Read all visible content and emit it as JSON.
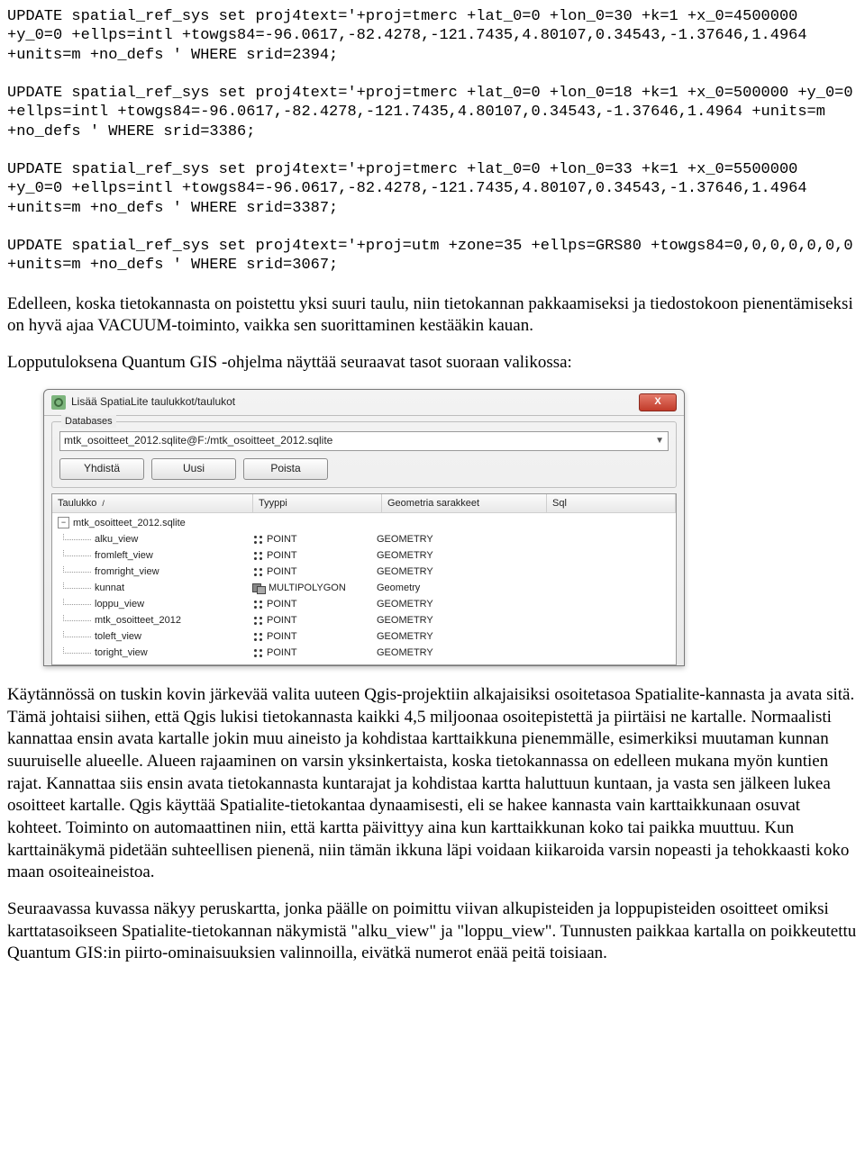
{
  "sql": {
    "stmt1": "UPDATE spatial_ref_sys set proj4text='+proj=tmerc +lat_0=0 +lon_0=30 +k=1 +x_0=4500000 +y_0=0 +ellps=intl +towgs84=-96.0617,-82.4278,-121.7435,4.80107,0.34543,-1.37646,1.4964 +units=m +no_defs ' WHERE srid=2394;",
    "stmt2": "UPDATE spatial_ref_sys set proj4text='+proj=tmerc +lat_0=0 +lon_0=18 +k=1 +x_0=500000 +y_0=0 +ellps=intl +towgs84=-96.0617,-82.4278,-121.7435,4.80107,0.34543,-1.37646,1.4964 +units=m +no_defs ' WHERE srid=3386;",
    "stmt3": "UPDATE spatial_ref_sys set proj4text='+proj=tmerc +lat_0=0 +lon_0=33 +k=1 +x_0=5500000 +y_0=0 +ellps=intl +towgs84=-96.0617,-82.4278,-121.7435,4.80107,0.34543,-1.37646,1.4964 +units=m +no_defs ' WHERE srid=3387;",
    "stmt4": "UPDATE spatial_ref_sys set proj4text='+proj=utm +zone=35 +ellps=GRS80 +towgs84=0,0,0,0,0,0,0 +units=m +no_defs ' WHERE srid=3067;"
  },
  "paragraphs": {
    "p1": "Edelleen, koska tietokannasta on poistettu yksi suuri taulu, niin tietokannan pakkaamiseksi ja tiedostokoon pienentämiseksi on hyvä ajaa VACUUM-toiminto, vaikka sen suorittaminen kestääkin kauan.",
    "p2": "Lopputuloksena Quantum GIS -ohjelma näyttää seuraavat tasot suoraan valikossa:",
    "p3": "Käytännössä on tuskin kovin järkevää valita uuteen Qgis-projektiin alkajaisiksi osoitetasoa Spatialite-kannasta ja avata sitä.  Tämä johtaisi siihen, että Qgis lukisi tietokannasta kaikki 4,5 miljoonaa osoitepistettä ja piirtäisi ne kartalle.  Normaalisti kannattaa ensin avata kartalle jokin muu aineisto ja kohdistaa karttaikkuna pienemmälle, esimerkiksi muutaman kunnan suuruiselle alueelle.  Alueen rajaaminen on varsin yksinkertaista, koska tietokannassa on edelleen mukana myön kuntien rajat.  Kannattaa siis ensin avata tietokannasta kuntarajat ja kohdistaa kartta haluttuun kuntaan, ja vasta sen jälkeen lukea osoitteet kartalle.  Qgis käyttää Spatialite-tietokantaa dynaamisesti, eli se hakee kannasta vain karttaikkunaan osuvat kohteet.  Toiminto on automaattinen niin, että kartta päivittyy aina kun karttaikkunan koko tai paikka muuttuu.  Kun karttainäkymä pidetään suhteellisen pienenä, niin tämän ikkuna läpi voidaan kiikaroida varsin nopeasti ja tehokkaasti koko maan osoiteaineistoa.",
    "p4": "Seuraavassa kuvassa näkyy  peruskartta, jonka päälle on poimittu viivan alkupisteiden ja loppupisteiden osoitteet omiksi karttatasoikseen Spatialite-tietokannan näkymistä \"alku_view\" ja \"loppu_view\".  Tunnusten paikkaa kartalla on poikkeutettu Quantum GIS:in piirto-ominaisuuksien valinnoilla, eivätkä numerot enää peitä toisiaan."
  },
  "dialog": {
    "title": "Lisää SpatiaLite taulukkot/taulukot",
    "close": "X",
    "group_label": "Databases",
    "combo_value": "mtk_osoitteet_2012.sqlite@F:/mtk_osoitteet_2012.sqlite",
    "btn_connect": "Yhdistä",
    "btn_new": "Uusi",
    "btn_delete": "Poista",
    "headers": {
      "table": "Taulukko",
      "type": "Tyyppi",
      "geom": "Geometria sarakkeet",
      "sql": "Sql"
    },
    "root": "mtk_osoitteet_2012.sqlite",
    "rows": [
      {
        "name": "alku_view",
        "type": "POINT",
        "geom": "GEOMETRY",
        "icon": "pt"
      },
      {
        "name": "fromleft_view",
        "type": "POINT",
        "geom": "GEOMETRY",
        "icon": "pt"
      },
      {
        "name": "fromright_view",
        "type": "POINT",
        "geom": "GEOMETRY",
        "icon": "pt"
      },
      {
        "name": "kunnat",
        "type": "MULTIPOLYGON",
        "geom": "Geometry",
        "icon": "mp"
      },
      {
        "name": "loppu_view",
        "type": "POINT",
        "geom": "GEOMETRY",
        "icon": "pt"
      },
      {
        "name": "mtk_osoitteet_2012",
        "type": "POINT",
        "geom": "GEOMETRY",
        "icon": "pt"
      },
      {
        "name": "toleft_view",
        "type": "POINT",
        "geom": "GEOMETRY",
        "icon": "pt"
      },
      {
        "name": "toright_view",
        "type": "POINT",
        "geom": "GEOMETRY",
        "icon": "pt"
      }
    ]
  }
}
